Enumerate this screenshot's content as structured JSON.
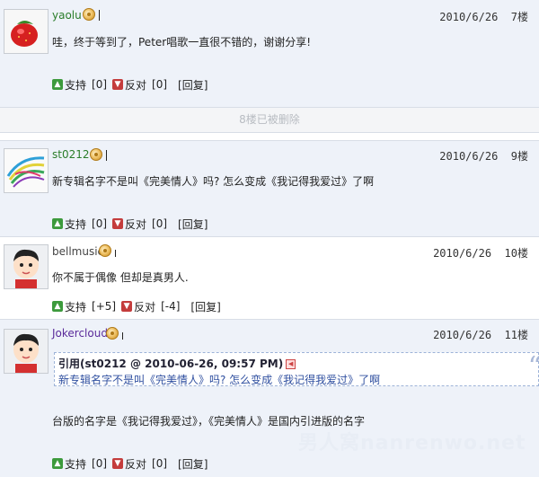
{
  "posts": [
    {
      "user": "yaolu",
      "datetime": "2010/6/26",
      "floor": "7楼",
      "message": "哇，终于等到了，Peter唱歌一直很不错的，谢谢分享!",
      "support_label": "支持",
      "support_count": "[0]",
      "oppose_label": "反对",
      "oppose_count": "[0]",
      "reply_label": "[回复]"
    },
    {
      "user": "st0212",
      "datetime": "2010/6/26",
      "floor": "9楼",
      "message": "新专辑名字不是叫《完美情人》吗? 怎么变成《我记得我爱过》了啊",
      "support_label": "支持",
      "support_count": "[0]",
      "oppose_label": "反对",
      "oppose_count": "[0]",
      "reply_label": "[回复]"
    },
    {
      "user": "bellmusic",
      "datetime": "2010/6/26",
      "floor": "10楼",
      "message": "你不属于偶像 但却是真男人.",
      "support_label": "支持",
      "support_count": "[+5]",
      "oppose_label": "反对",
      "oppose_count": "[-4]",
      "reply_label": "[回复]"
    },
    {
      "user": "Jokercloud",
      "datetime": "2010/6/26",
      "floor": "11楼",
      "message": "台版的名字是《我记得我爱过》，《完美情人》是国内引进版的名字",
      "support_label": "支持",
      "support_count": "[0]",
      "oppose_label": "反对",
      "oppose_count": "[0]",
      "reply_label": "[回复]"
    }
  ],
  "deleted_notice": "8楼已被删除",
  "quote": {
    "header": "引用(st0212 @ 2010-06-26, 09:57 PM)",
    "body": "新专辑名字不是叫《完美情人》吗? 怎么变成《我记得我爱过》了啊"
  },
  "watermark": "男人窝nanrenwo.net",
  "colors": {
    "support": "#3c9a3c",
    "oppose": "#c43c3c",
    "post_bg": "#eef2f9"
  }
}
